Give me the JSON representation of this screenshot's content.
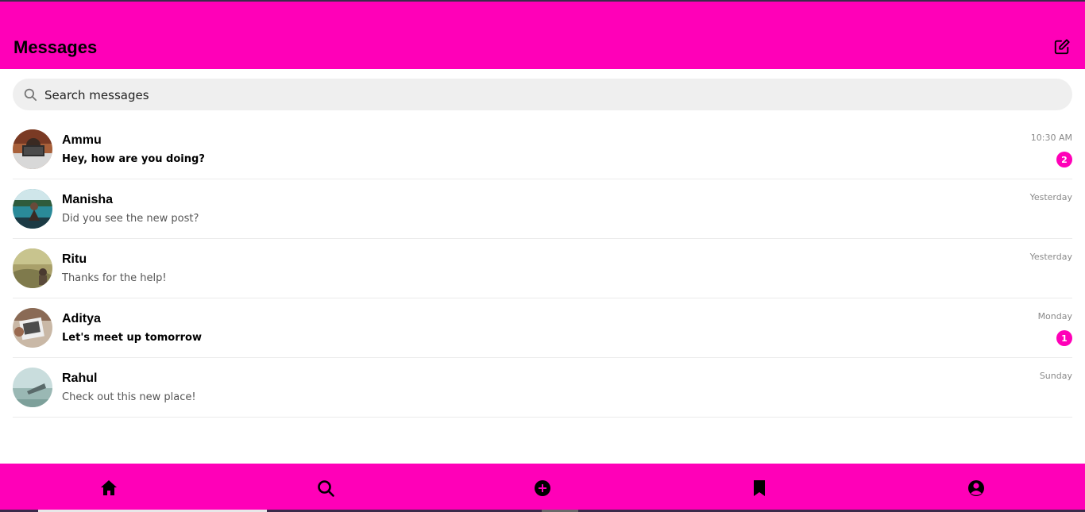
{
  "header": {
    "title": "Messages",
    "compose_icon": "compose-icon"
  },
  "search": {
    "placeholder": "Search messages",
    "icon": "search-icon"
  },
  "conversations": [
    {
      "name": "Ammu",
      "preview": "Hey, how are you doing?",
      "time": "10:30 AM",
      "unread": "2"
    },
    {
      "name": "Manisha",
      "preview": "Did you see the new post?",
      "time": "Yesterday",
      "unread": ""
    },
    {
      "name": "Ritu",
      "preview": "Thanks for the help!",
      "time": "Yesterday",
      "unread": ""
    },
    {
      "name": "Aditya",
      "preview": "Let's meet up tomorrow",
      "time": "Monday",
      "unread": "1"
    },
    {
      "name": "Rahul",
      "preview": "Check out this new place!",
      "time": "Sunday",
      "unread": ""
    }
  ],
  "bottom_nav": [
    {
      "icon": "home-icon"
    },
    {
      "icon": "search-icon"
    },
    {
      "icon": "add-circle-icon"
    },
    {
      "icon": "bookmark-icon"
    },
    {
      "icon": "profile-icon"
    }
  ],
  "colors": {
    "accent": "#ff00b8",
    "unread_badge": "#ff00b8"
  }
}
